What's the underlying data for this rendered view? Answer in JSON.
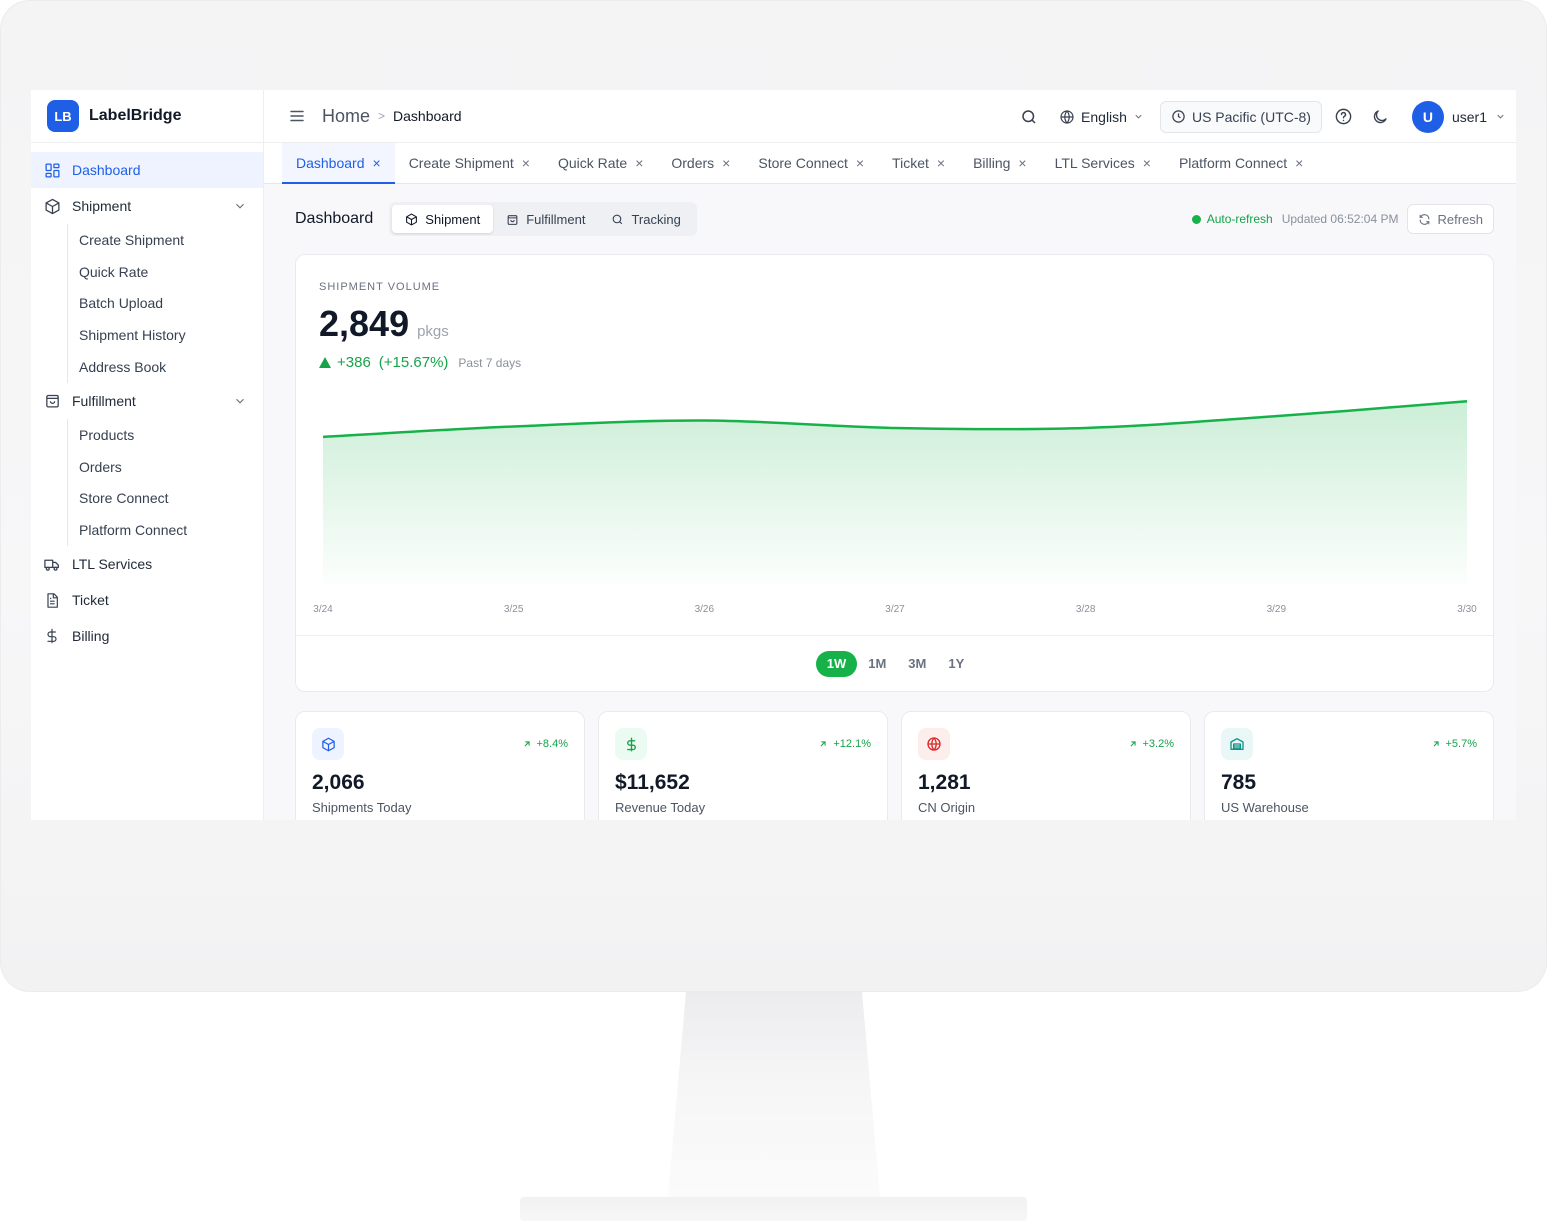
{
  "brand": {
    "logo_text": "LB",
    "name": "LabelBridge"
  },
  "sidebar": {
    "items": [
      {
        "label": "Dashboard",
        "icon": "dashboard-grid-icon",
        "active": true
      },
      {
        "label": "Shipment",
        "icon": "box-icon",
        "expanded": true,
        "children": [
          "Create Shipment",
          "Quick Rate",
          "Batch Upload",
          "Shipment History",
          "Address Book"
        ]
      },
      {
        "label": "Fulfillment",
        "icon": "shopping-bag-icon",
        "expanded": true,
        "children": [
          "Products",
          "Orders",
          "Store Connect",
          "Platform Connect"
        ]
      },
      {
        "label": "LTL Services",
        "icon": "truck-icon"
      },
      {
        "label": "Ticket",
        "icon": "document-icon"
      },
      {
        "label": "Billing",
        "icon": "dollar-icon"
      }
    ]
  },
  "header": {
    "breadcrumb_home": "Home",
    "breadcrumb_separator": ">",
    "breadcrumb_current": "Dashboard",
    "language": "English",
    "timezone": "US Pacific (UTC-8)",
    "avatar_initial": "U",
    "username": "user1"
  },
  "tabs": [
    {
      "label": "Dashboard",
      "active": true
    },
    {
      "label": "Create Shipment"
    },
    {
      "label": "Quick Rate"
    },
    {
      "label": "Orders"
    },
    {
      "label": "Store Connect"
    },
    {
      "label": "Ticket"
    },
    {
      "label": "Billing"
    },
    {
      "label": "LTL Services"
    },
    {
      "label": "Platform Connect"
    }
  ],
  "tab_close_glyph": "×",
  "toolbar": {
    "title": "Dashboard",
    "segments": [
      {
        "label": "Shipment",
        "icon": "box-icon",
        "active": true
      },
      {
        "label": "Fulfillment",
        "icon": "shopping-bag-icon"
      },
      {
        "label": "Tracking",
        "icon": "search-icon"
      }
    ],
    "auto_refresh": "Auto-refresh",
    "updated": "Updated 06:52:04 PM",
    "refresh_label": "Refresh"
  },
  "volume": {
    "label": "SHIPMENT VOLUME",
    "value": "2,849",
    "unit": "pkgs",
    "delta": "+386",
    "delta_pct": "(+15.67%)",
    "period": "Past 7 days",
    "ranges": [
      {
        "label": "1W",
        "active": true
      },
      {
        "label": "1M"
      },
      {
        "label": "3M"
      },
      {
        "label": "1Y"
      }
    ]
  },
  "chart_data": {
    "type": "area",
    "x": [
      "3/24",
      "3/25",
      "3/26",
      "3/27",
      "3/28",
      "3/29",
      "3/30"
    ],
    "series": [
      {
        "values": [
          400,
          407,
          411,
          406,
          406,
          414,
          424
        ]
      }
    ],
    "ylim": [
      300,
      435
    ],
    "grid": false,
    "line_color": "#16b249",
    "fill_color": "#16b249"
  },
  "stats": [
    {
      "value": "2,066",
      "label": "Shipments Today",
      "delta": "+8.4%",
      "icon": "box-icon",
      "icon_color": "#1f5fe6",
      "icon_bg": "#eef3ff"
    },
    {
      "value": "$11,652",
      "label": "Revenue Today",
      "delta": "+12.1%",
      "icon": "dollar-icon",
      "icon_color": "#16a34a",
      "icon_bg": "#ecfbf1"
    },
    {
      "value": "1,281",
      "label": "CN Origin",
      "delta": "+3.2%",
      "icon": "globe-icon",
      "icon_color": "#dc2626",
      "icon_bg": "#fdeeee"
    },
    {
      "value": "785",
      "label": "US Warehouse",
      "delta": "+5.7%",
      "icon": "warehouse-icon",
      "icon_color": "#0d9488",
      "icon_bg": "#e9f8f6"
    }
  ],
  "colors": {
    "accent": "#1f5fe6",
    "success": "#16b249"
  }
}
